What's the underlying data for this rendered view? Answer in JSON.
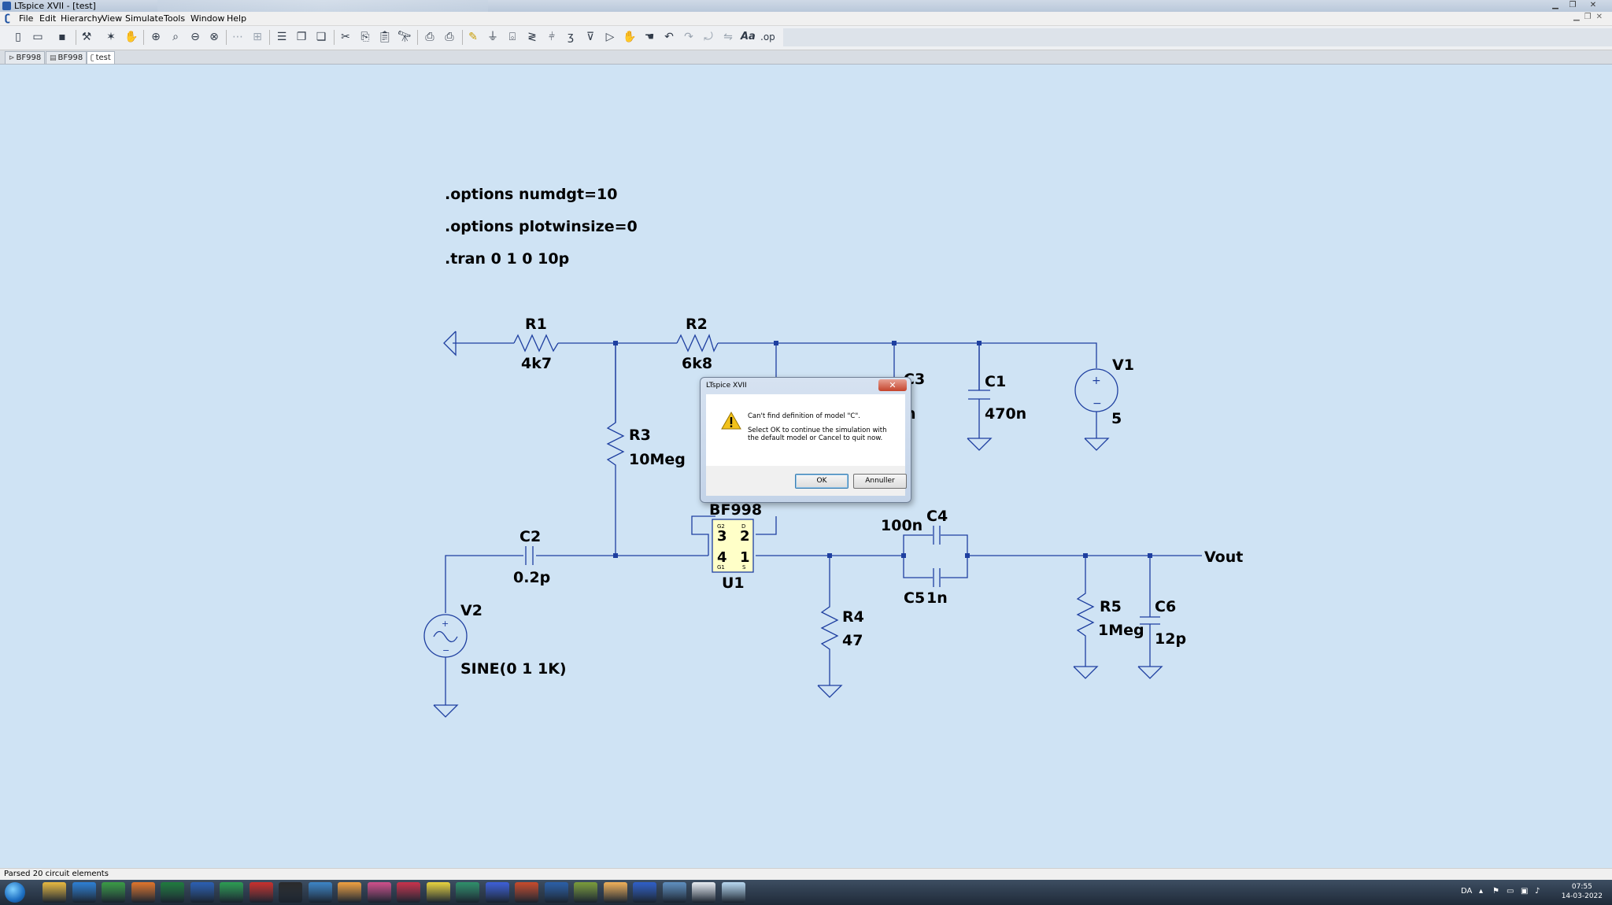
{
  "window": {
    "title": "LTspice XVII - [test]"
  },
  "menu": [
    "File",
    "Edit",
    "Hierarchy",
    "View",
    "Simulate",
    "Tools",
    "Window",
    "Help"
  ],
  "toolbar_icons": [
    "new-schematic-icon",
    "open-icon",
    "save-icon",
    "control-panel-icon",
    "run-icon",
    "halt-icon",
    "pan-icon",
    "zoom-in-icon",
    "zoom-area-icon",
    "zoom-out-icon",
    "zoom-fit-icon",
    "autoscale-icon",
    "grid-icon",
    "tile-horizontal-icon",
    "tile-vertical-icon",
    "cascade-icon",
    "cut-icon",
    "copy-icon",
    "paste-icon",
    "find-icon",
    "print-icon",
    "print-setup-icon",
    "draw-wire-icon",
    "ground-icon",
    "label-net-icon",
    "resistor-icon",
    "capacitor-icon",
    "inductor-icon",
    "diode-icon",
    "component-icon",
    "move-icon",
    "drag-icon",
    "undo-icon",
    "redo-icon",
    "rotate-icon",
    "mirror-icon",
    "text-icon",
    "spice-directive-icon"
  ],
  "tabs": [
    {
      "label": "BF998",
      "icon": "symbol-icon"
    },
    {
      "label": "BF998",
      "icon": "netlist-icon"
    },
    {
      "label": "test",
      "icon": "schematic-icon",
      "active": true
    }
  ],
  "schematic": {
    "directives": [
      ".options numdgt=10",
      ".options plotwinsize=0",
      ".tran 0 1 0 10p"
    ],
    "components": {
      "R1": {
        "name": "R1",
        "value": "4k7"
      },
      "R2": {
        "name": "R2",
        "value": "6k8"
      },
      "R3": {
        "name": "R3",
        "value": "10Meg"
      },
      "R4": {
        "name": "R4",
        "value": "47"
      },
      "R5": {
        "name": "R5",
        "value": "1Meg"
      },
      "C1": {
        "name": "C1",
        "value": "470n"
      },
      "C2": {
        "name": "C2",
        "value": "0.2p"
      },
      "C3": {
        "name": "C3",
        "value": "n"
      },
      "C4": {
        "name": "C4",
        "value": "100n"
      },
      "C5": {
        "name": "C5",
        "value": "1n"
      },
      "C6": {
        "name": "C6",
        "value": "12p"
      },
      "V1": {
        "name": "V1",
        "value": "5"
      },
      "V2": {
        "name": "V2",
        "value": "SINE(0 1 1K)"
      },
      "U1": {
        "name": "U1",
        "model": "BF998",
        "pins": [
          "3",
          "2",
          "4",
          "1"
        ],
        "pin_tags": [
          "G2",
          "D",
          "G1",
          "S"
        ]
      }
    },
    "net_labels": {
      "vout": "Vout"
    }
  },
  "dialog": {
    "title": "LTspice XVII",
    "close": "✕",
    "message": "Can't find definition of model \"C\".",
    "detail": "Select OK to continue the simulation with the default model or Cancel to quit now.",
    "ok": "OK",
    "cancel": "Annuller"
  },
  "status": {
    "text": "Parsed 20 circuit elements"
  },
  "taskbar": {
    "language": "DA",
    "time": "07:55",
    "date": "14-03-2022",
    "apps": [
      "explorer",
      "outlook",
      "chrome",
      "firefox",
      "excel",
      "word",
      "sheets",
      "acrobat",
      "steam",
      "ltspice",
      "paint",
      "notepad++",
      "picasa",
      "bulb",
      "app",
      "kicad",
      "matlab",
      "virtualbox",
      "palette",
      "binder",
      "emacs",
      "control-panel",
      "docs",
      "sticky"
    ]
  }
}
